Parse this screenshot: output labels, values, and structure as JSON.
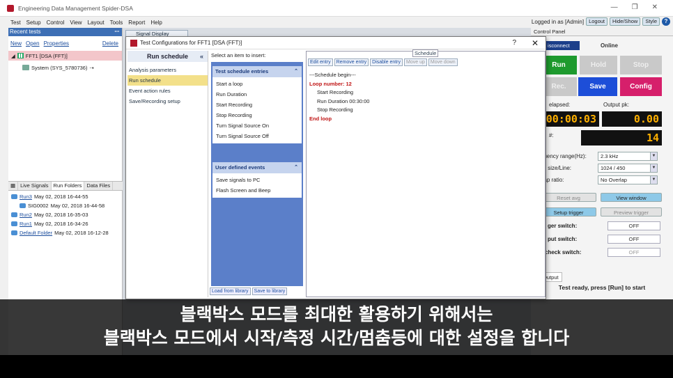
{
  "window": {
    "title": "Engineering Data Management Spider-DSA"
  },
  "menu": {
    "items": [
      "Test",
      "Setup",
      "Control",
      "View",
      "Layout",
      "Tools",
      "Report",
      "Help"
    ],
    "login": "Logged in as [Admin]",
    "logout": "Logout",
    "hideshow": "Hide/Show",
    "style": "Style",
    "help": "?"
  },
  "left": {
    "header": "Recent tests",
    "links": {
      "new": "New",
      "open": "Open",
      "properties": "Properties",
      "delete": "Delete"
    },
    "test": "FFT1   [DSA (FFT)]",
    "system": "System (SYS_5780736)",
    "tabs": [
      "Live Signals",
      "Run Folders",
      "Data Files"
    ],
    "runs": [
      {
        "name": "Run3",
        "date": "May 02, 2018 16-44-55"
      },
      {
        "name": "SIG0002",
        "date": "May 02, 2018 16-44-58"
      },
      {
        "name": "Run2",
        "date": "May 02, 2018 16-35-03"
      },
      {
        "name": "Run1",
        "date": "May 02, 2018 16-34-26"
      },
      {
        "name": "Default Folder",
        "date": "May 02, 2018 16-12-28"
      }
    ]
  },
  "signal_tab": "Signal Display",
  "control": {
    "header": "Control Panel",
    "disconnect": "isconnect",
    "status": "Online",
    "buttons": {
      "run": "Run",
      "hold": "Hold",
      "stop": "Stop",
      "rec": "Rec.",
      "save": "Save",
      "config": "Config"
    },
    "elapsed_label": "elapsed:",
    "output_label": "Output pk:",
    "elapsed": "00:00:03",
    "output": "0.00",
    "count_label": "#:",
    "count": "14",
    "freq_label": "quency range(Hz):",
    "freq": "2.3 kHz",
    "block_label": "ck size/Line:",
    "block": "1024 / 450",
    "overlap_label": "rlap ratio:",
    "overlap": "No Overlap",
    "reset_avg": "Reset avg",
    "view_window": "View window",
    "setup_trigger": "Setup trigger",
    "preview_trigger": "Preview trigger",
    "switch1_label": "ger switch:",
    "switch2_label": "put switch:",
    "switch3_label": "check switch:",
    "off": "OFF",
    "tabs": [
      "t",
      "Output"
    ],
    "ready": "Test ready, press [Run] to start"
  },
  "dialog": {
    "title": "Test Configurations for FFT1 [DSA (FFT)]",
    "help": "?",
    "close": "✕",
    "nav_header": "Run schedule",
    "nav_items": [
      "Analysis parameters",
      "Run schedule",
      "Event action rules",
      "Save/Recording setup"
    ],
    "insert_label": "Select an item to insert:",
    "group1": {
      "title": "Test schedule entries",
      "items": [
        "Start a loop",
        "Run Duration",
        "Start Recording",
        "Stop Recording",
        "Turn Signal Source On",
        "Turn Signal Source Off"
      ]
    },
    "group2": {
      "title": "User defined events",
      "items": [
        "Save signals to PC",
        "Flash Screen and Beep"
      ]
    },
    "load": "Load from library",
    "save": "Save to library",
    "schedule_title": "Schedule",
    "schedule_buttons": [
      "Edit entry",
      "Remove entry",
      "Disable entry",
      "Move up",
      "Move down"
    ],
    "schedule": [
      "---Schedule begin---",
      "Loop number: 12",
      "Start Recording",
      "Run Duration 00:30:00",
      "Stop Recording",
      "End loop"
    ]
  },
  "caption": {
    "line1": "블랙박스 모드를 최대한 활용하기 위해서는",
    "line2": "블랙박스 모드에서 시작/측정 시간/멈춤등에 대한 설정을 합니다"
  }
}
